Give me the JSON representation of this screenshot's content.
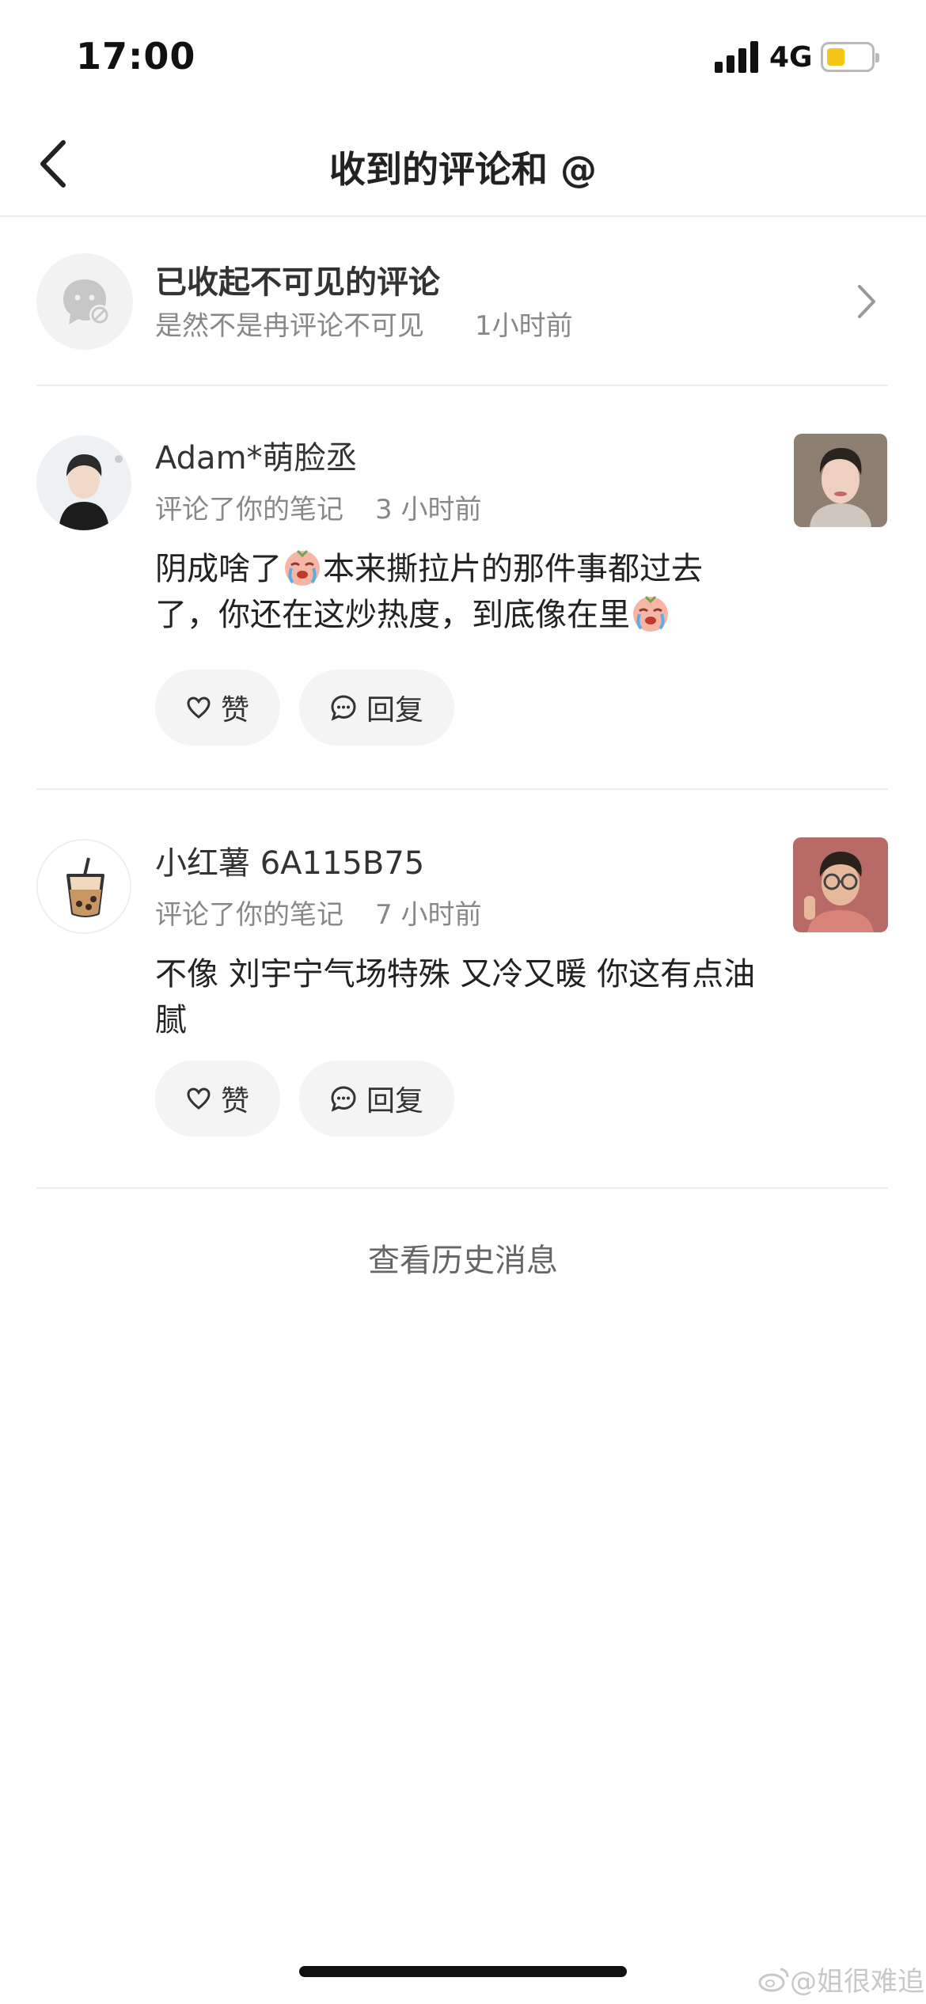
{
  "status_bar": {
    "time": "17:00",
    "network": "4G"
  },
  "nav": {
    "title": "收到的评论和 @"
  },
  "folded": {
    "title": "已收起不可见的评论",
    "subtitle": "是然不是冉评论不可见",
    "time": "1小时前"
  },
  "comments": [
    {
      "username": "Adam*萌脸丞",
      "action": "评论了你的笔记",
      "time": "3 小时前",
      "text_part1": "阴成啥了",
      "text_part2": "本来撕拉片的那件事都过去了，你还在这炒热度，到底像在里",
      "like_label": "赞",
      "reply_label": "回复"
    },
    {
      "username": "小红薯 6A115B75",
      "action": "评论了你的笔记",
      "time": "7 小时前",
      "text": "不像 刘宇宁气场特殊 又冷又暖 你这有点油腻",
      "like_label": "赞",
      "reply_label": "回复"
    }
  ],
  "history_link": "查看历史消息",
  "watermark": "@姐很难追",
  "colors": {
    "battery_fill": "#f5c518",
    "pill_bg": "#f4f4f4",
    "divider": "#ededed"
  }
}
